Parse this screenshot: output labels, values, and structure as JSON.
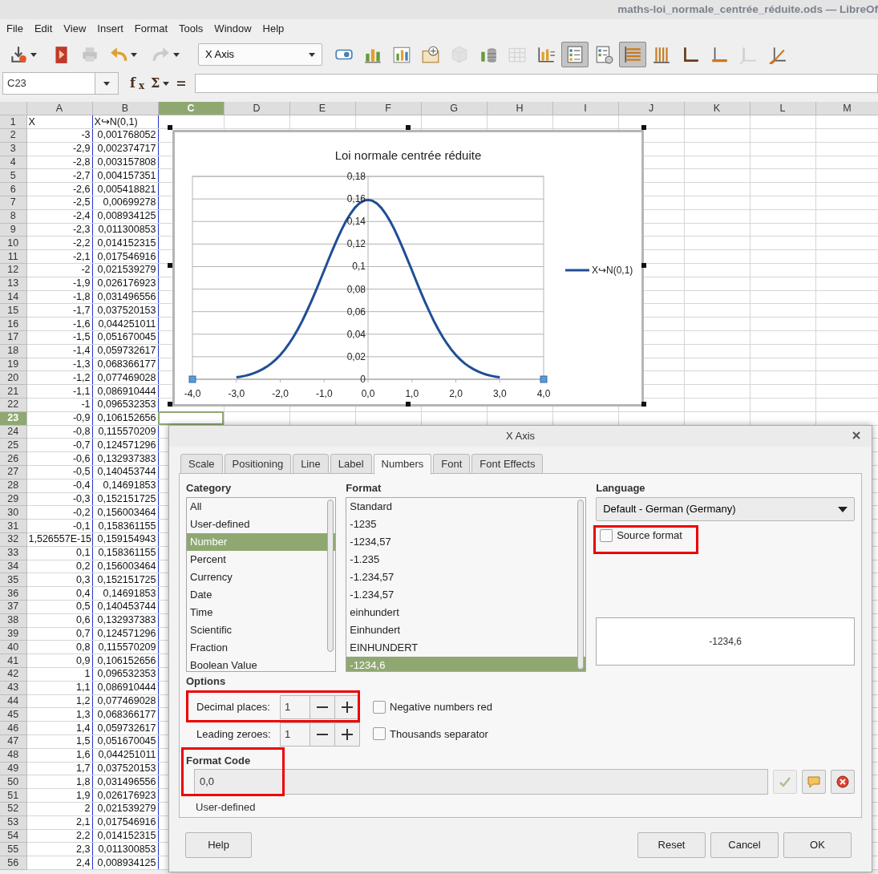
{
  "window": {
    "title": "maths-loi_normale_centrée_réduite.ods — LibreOf"
  },
  "menu": [
    "File",
    "Edit",
    "View",
    "Insert",
    "Format",
    "Tools",
    "Window",
    "Help"
  ],
  "toolbar": [
    {
      "kind": "save",
      "disabled": false,
      "pressed": false,
      "dropdown": true
    },
    {
      "kind": "pdf",
      "disabled": false,
      "pressed": false
    },
    {
      "kind": "print",
      "disabled": true,
      "pressed": false
    },
    {
      "kind": "undo",
      "disabled": false,
      "pressed": false,
      "dropdown": true
    },
    {
      "kind": "redo",
      "disabled": true,
      "pressed": false,
      "dropdown": true
    },
    {
      "kind": "select",
      "label": "X Axis"
    },
    {
      "kind": "format",
      "disabled": false,
      "pressed": false
    },
    {
      "kind": "charttype",
      "disabled": false,
      "pressed": false
    },
    {
      "kind": "datarange",
      "disabled": false,
      "pressed": false
    },
    {
      "kind": "chartdata",
      "disabled": false,
      "pressed": false
    },
    {
      "kind": "cube",
      "disabled": true,
      "pressed": false
    },
    {
      "kind": "series",
      "disabled": false,
      "pressed": false
    },
    {
      "kind": "table",
      "disabled": true,
      "pressed": false
    },
    {
      "kind": "titles",
      "disabled": false,
      "pressed": false
    },
    {
      "kind": "legendtoggle",
      "disabled": false,
      "pressed": true
    },
    {
      "kind": "legend",
      "disabled": false,
      "pressed": false
    },
    {
      "kind": "hgrid",
      "disabled": false,
      "pressed": true
    },
    {
      "kind": "vgrid",
      "disabled": false,
      "pressed": false
    },
    {
      "kind": "axes",
      "disabled": false,
      "pressed": false
    },
    {
      "kind": "xaxis",
      "disabled": false,
      "pressed": false
    },
    {
      "kind": "yaxis",
      "disabled": true,
      "pressed": false
    },
    {
      "kind": "zaxis",
      "disabled": false,
      "pressed": false
    }
  ],
  "formula_bar": {
    "name_box": "C23",
    "function_wizard": "f$_{x}$",
    "sum": "Σ",
    "equals": "="
  },
  "sheet": {
    "columns": [
      {
        "label": "A",
        "selected": false,
        "highlighted": true
      },
      {
        "label": "B",
        "selected": false,
        "highlighted": true
      },
      {
        "label": "C",
        "selected": true,
        "highlighted": false
      },
      {
        "label": "D",
        "selected": false,
        "highlighted": false
      },
      {
        "label": "E",
        "selected": false,
        "highlighted": false
      },
      {
        "label": "F",
        "selected": false,
        "highlighted": false
      },
      {
        "label": "G",
        "selected": false,
        "highlighted": false
      },
      {
        "label": "H",
        "selected": false,
        "highlighted": false
      },
      {
        "label": "I",
        "selected": false,
        "highlighted": false
      },
      {
        "label": "J",
        "selected": false,
        "highlighted": false
      },
      {
        "label": "K",
        "selected": false,
        "highlighted": false
      },
      {
        "label": "L",
        "selected": false,
        "highlighted": false
      },
      {
        "label": "M",
        "selected": false,
        "highlighted": false
      }
    ],
    "rows": [
      {
        "label": "1",
        "selected": false,
        "kind": "text",
        "cells": [
          "X",
          "X↪N(0,1)"
        ]
      },
      {
        "label": "2",
        "selected": false,
        "kind": "number",
        "cells": [
          "-3",
          "0,001768052"
        ]
      },
      {
        "label": "3",
        "selected": false,
        "kind": "number",
        "cells": [
          "-2,9",
          "0,002374717"
        ]
      },
      {
        "label": "4",
        "selected": false,
        "kind": "number",
        "cells": [
          "-2,8",
          "0,003157808"
        ]
      },
      {
        "label": "5",
        "selected": false,
        "kind": "number",
        "cells": [
          "-2,7",
          "0,004157351"
        ]
      },
      {
        "label": "6",
        "selected": false,
        "kind": "number",
        "cells": [
          "-2,6",
          "0,005418821"
        ]
      },
      {
        "label": "7",
        "selected": false,
        "kind": "number",
        "cells": [
          "-2,5",
          "0,00699278"
        ]
      },
      {
        "label": "8",
        "selected": false,
        "kind": "number",
        "cells": [
          "-2,4",
          "0,008934125"
        ]
      },
      {
        "label": "9",
        "selected": false,
        "kind": "number",
        "cells": [
          "-2,3",
          "0,011300853"
        ]
      },
      {
        "label": "10",
        "selected": false,
        "kind": "number",
        "cells": [
          "-2,2",
          "0,014152315"
        ]
      },
      {
        "label": "11",
        "selected": false,
        "kind": "number",
        "cells": [
          "-2,1",
          "0,017546916"
        ]
      },
      {
        "label": "12",
        "selected": false,
        "kind": "number",
        "cells": [
          "-2",
          "0,021539279"
        ]
      },
      {
        "label": "13",
        "selected": false,
        "kind": "number",
        "cells": [
          "-1,9",
          "0,026176923"
        ]
      },
      {
        "label": "14",
        "selected": false,
        "kind": "number",
        "cells": [
          "-1,8",
          "0,031496556"
        ]
      },
      {
        "label": "15",
        "selected": false,
        "kind": "number",
        "cells": [
          "-1,7",
          "0,037520153"
        ]
      },
      {
        "label": "16",
        "selected": false,
        "kind": "number",
        "cells": [
          "-1,6",
          "0,044251011"
        ]
      },
      {
        "label": "17",
        "selected": false,
        "kind": "number",
        "cells": [
          "-1,5",
          "0,051670045"
        ]
      },
      {
        "label": "18",
        "selected": false,
        "kind": "number",
        "cells": [
          "-1,4",
          "0,059732617"
        ]
      },
      {
        "label": "19",
        "selected": false,
        "kind": "number",
        "cells": [
          "-1,3",
          "0,068366177"
        ]
      },
      {
        "label": "20",
        "selected": false,
        "kind": "number",
        "cells": [
          "-1,2",
          "0,077469028"
        ]
      },
      {
        "label": "21",
        "selected": false,
        "kind": "number",
        "cells": [
          "-1,1",
          "0,086910444"
        ]
      },
      {
        "label": "22",
        "selected": false,
        "kind": "number",
        "cells": [
          "-1",
          "0,096532353"
        ]
      },
      {
        "label": "23",
        "selected": true,
        "kind": "number",
        "cells": [
          "-0,9",
          "0,106152656"
        ]
      },
      {
        "label": "24",
        "selected": false,
        "kind": "number",
        "cells": [
          "-0,8",
          "0,115570209"
        ]
      },
      {
        "label": "25",
        "selected": false,
        "kind": "number",
        "cells": [
          "-0,7",
          "0,124571296"
        ]
      },
      {
        "label": "26",
        "selected": false,
        "kind": "number",
        "cells": [
          "-0,6",
          "0,132937383"
        ]
      },
      {
        "label": "27",
        "selected": false,
        "kind": "number",
        "cells": [
          "-0,5",
          "0,140453744"
        ]
      },
      {
        "label": "28",
        "selected": false,
        "kind": "number",
        "cells": [
          "-0,4",
          "0,14691853"
        ]
      },
      {
        "label": "29",
        "selected": false,
        "kind": "number",
        "cells": [
          "-0,3",
          "0,152151725"
        ]
      },
      {
        "label": "30",
        "selected": false,
        "kind": "number",
        "cells": [
          "-0,2",
          "0,156003464"
        ]
      },
      {
        "label": "31",
        "selected": false,
        "kind": "number",
        "cells": [
          "-0,1",
          "0,158361155"
        ]
      },
      {
        "label": "32",
        "selected": false,
        "kind": "number",
        "cells": [
          "1,526557E-15",
          "0,159154943"
        ]
      },
      {
        "label": "33",
        "selected": false,
        "kind": "number",
        "cells": [
          "0,1",
          "0,158361155"
        ]
      },
      {
        "label": "34",
        "selected": false,
        "kind": "number",
        "cells": [
          "0,2",
          "0,156003464"
        ]
      },
      {
        "label": "35",
        "selected": false,
        "kind": "number",
        "cells": [
          "0,3",
          "0,152151725"
        ]
      },
      {
        "label": "36",
        "selected": false,
        "kind": "number",
        "cells": [
          "0,4",
          "0,14691853"
        ]
      },
      {
        "label": "37",
        "selected": false,
        "kind": "number",
        "cells": [
          "0,5",
          "0,140453744"
        ]
      },
      {
        "label": "38",
        "selected": false,
        "kind": "number",
        "cells": [
          "0,6",
          "0,132937383"
        ]
      },
      {
        "label": "39",
        "selected": false,
        "kind": "number",
        "cells": [
          "0,7",
          "0,124571296"
        ]
      },
      {
        "label": "40",
        "selected": false,
        "kind": "number",
        "cells": [
          "0,8",
          "0,115570209"
        ]
      },
      {
        "label": "41",
        "selected": false,
        "kind": "number",
        "cells": [
          "0,9",
          "0,106152656"
        ]
      },
      {
        "label": "42",
        "selected": false,
        "kind": "number",
        "cells": [
          "1",
          "0,096532353"
        ]
      },
      {
        "label": "43",
        "selected": false,
        "kind": "number",
        "cells": [
          "1,1",
          "0,086910444"
        ]
      },
      {
        "label": "44",
        "selected": false,
        "kind": "number",
        "cells": [
          "1,2",
          "0,077469028"
        ]
      },
      {
        "label": "45",
        "selected": false,
        "kind": "number",
        "cells": [
          "1,3",
          "0,068366177"
        ]
      },
      {
        "label": "46",
        "selected": false,
        "kind": "number",
        "cells": [
          "1,4",
          "0,059732617"
        ]
      },
      {
        "label": "47",
        "selected": false,
        "kind": "number",
        "cells": [
          "1,5",
          "0,051670045"
        ]
      },
      {
        "label": "48",
        "selected": false,
        "kind": "number",
        "cells": [
          "1,6",
          "0,044251011"
        ]
      },
      {
        "label": "49",
        "selected": false,
        "kind": "number",
        "cells": [
          "1,7",
          "0,037520153"
        ]
      },
      {
        "label": "50",
        "selected": false,
        "kind": "number",
        "cells": [
          "1,8",
          "0,031496556"
        ]
      },
      {
        "label": "51",
        "selected": false,
        "kind": "number",
        "cells": [
          "1,9",
          "0,026176923"
        ]
      },
      {
        "label": "52",
        "selected": false,
        "kind": "number",
        "cells": [
          "2",
          "0,021539279"
        ]
      },
      {
        "label": "53",
        "selected": false,
        "kind": "number",
        "cells": [
          "2,1",
          "0,017546916"
        ]
      },
      {
        "label": "54",
        "selected": false,
        "kind": "number",
        "cells": [
          "2,2",
          "0,014152315"
        ]
      },
      {
        "label": "55",
        "selected": false,
        "kind": "number",
        "cells": [
          "2,3",
          "0,011300853"
        ]
      },
      {
        "label": "56",
        "selected": false,
        "kind": "number",
        "cells": [
          "2,4",
          "0,008934125"
        ]
      }
    ]
  },
  "chart": {
    "selected": true,
    "x_axis_selected": true,
    "chart_data": {
      "type": "line",
      "title": "Loi normale centrée réduite",
      "x": [
        -3,
        -2.9,
        -2.8,
        -2.7,
        -2.6,
        -2.5,
        -2.4,
        -2.3,
        -2.2,
        -2.1,
        -2,
        -1.9,
        -1.8,
        -1.7,
        -1.6,
        -1.5,
        -1.4,
        -1.3,
        -1.2,
        -1.1,
        -1,
        -0.9,
        -0.8,
        -0.7,
        -0.6,
        -0.5,
        -0.4,
        -0.3,
        -0.2,
        -0.1,
        0,
        0.1,
        0.2,
        0.3,
        0.4,
        0.5,
        0.6,
        0.7,
        0.8,
        0.9,
        1,
        1.1,
        1.2,
        1.3,
        1.4,
        1.5,
        1.6,
        1.7,
        1.8,
        1.9,
        2,
        2.1,
        2.2,
        2.3,
        2.4,
        2.5,
        2.6,
        2.7,
        2.8,
        2.9,
        3
      ],
      "series": [
        {
          "name": "X↪N(0,1)",
          "color": "#1f4e96",
          "values": [
            0.001768052,
            0.002374717,
            0.003157808,
            0.004157351,
            0.005418821,
            0.00699278,
            0.008934125,
            0.011300853,
            0.014152315,
            0.017546916,
            0.021539279,
            0.026176923,
            0.031496556,
            0.037520153,
            0.044251011,
            0.051670045,
            0.059732617,
            0.068366177,
            0.077469028,
            0.086910444,
            0.096532353,
            0.106152656,
            0.115570209,
            0.124571296,
            0.132937383,
            0.140453744,
            0.14691853,
            0.152151725,
            0.156003464,
            0.158361155,
            0.159154943,
            0.158361155,
            0.156003464,
            0.152151725,
            0.14691853,
            0.140453744,
            0.132937383,
            0.124571296,
            0.115570209,
            0.106152656,
            0.096532353,
            0.086910444,
            0.077469028,
            0.068366177,
            0.059732617,
            0.051670045,
            0.044251011,
            0.037520153,
            0.031496556,
            0.026176923,
            0.021539279,
            0.017546916,
            0.014152315,
            0.011300853,
            0.008934125,
            0.00699278,
            0.005418821,
            0.004157351,
            0.003157808,
            0.002374717,
            0.001768052
          ]
        }
      ],
      "xlim": [
        -4,
        4
      ],
      "ylim": [
        0,
        0.18
      ],
      "grid": true,
      "xticks": [
        {
          "value": -4,
          "label": "-4,0"
        },
        {
          "value": -3,
          "label": "-3,0"
        },
        {
          "value": -2,
          "label": "-2,0"
        },
        {
          "value": -1,
          "label": "-1,0"
        },
        {
          "value": 0,
          "label": "0,0"
        },
        {
          "value": 1,
          "label": "1,0"
        },
        {
          "value": 2,
          "label": "2,0"
        },
        {
          "value": 3,
          "label": "3,0"
        },
        {
          "value": 4,
          "label": "4,0"
        }
      ],
      "yticks": [
        {
          "value": 0,
          "label": "0"
        },
        {
          "value": 0.02,
          "label": "0,02"
        },
        {
          "value": 0.04,
          "label": "0,04"
        },
        {
          "value": 0.06,
          "label": "0,06"
        },
        {
          "value": 0.08,
          "label": "0,08"
        },
        {
          "value": 0.1,
          "label": "0,1"
        },
        {
          "value": 0.12,
          "label": "0,12"
        },
        {
          "value": 0.14,
          "label": "0,14"
        },
        {
          "value": 0.16,
          "label": "0,16"
        },
        {
          "value": 0.18,
          "label": "0,18"
        }
      ]
    }
  },
  "dialog": {
    "title": "X Axis",
    "tabs": [
      {
        "label": "Scale",
        "selected": false
      },
      {
        "label": "Positioning",
        "selected": false
      },
      {
        "label": "Line",
        "selected": false
      },
      {
        "label": "Label",
        "selected": false
      },
      {
        "label": "Numbers",
        "selected": true
      },
      {
        "label": "Font",
        "selected": false
      },
      {
        "label": "Font Effects",
        "selected": false
      }
    ],
    "category": {
      "label": "Category",
      "items": [
        {
          "label": "All",
          "selected": false
        },
        {
          "label": "User-defined",
          "selected": false
        },
        {
          "label": "Number",
          "selected": true
        },
        {
          "label": "Percent",
          "selected": false
        },
        {
          "label": "Currency",
          "selected": false
        },
        {
          "label": "Date",
          "selected": false
        },
        {
          "label": "Time",
          "selected": false
        },
        {
          "label": "Scientific",
          "selected": false
        },
        {
          "label": "Fraction",
          "selected": false
        },
        {
          "label": "Boolean Value",
          "selected": false
        }
      ]
    },
    "format": {
      "label": "Format",
      "items": [
        {
          "label": "Standard",
          "selected": false
        },
        {
          "label": "-1235",
          "selected": false
        },
        {
          "label": "-1234,57",
          "selected": false
        },
        {
          "label": "-1.235",
          "selected": false
        },
        {
          "label": "-1.234,57",
          "selected": false
        },
        {
          "label": "-1.234,57",
          "selected": false
        },
        {
          "label": "einhundert",
          "selected": false
        },
        {
          "label": "Einhundert",
          "selected": false
        },
        {
          "label": "EINHUNDERT",
          "selected": false
        },
        {
          "label": "-1234,6",
          "selected": true
        }
      ]
    },
    "language": {
      "label": "Language",
      "value": "Default - German (Germany)"
    },
    "source_format": {
      "label": "Source format",
      "checked": false,
      "highlighted": true
    },
    "preview": "-1234,6",
    "options": {
      "label": "Options",
      "decimal_places": {
        "label": "Decimal places:",
        "value": "1",
        "highlighted": true
      },
      "leading_zeroes": {
        "label": "Leading zeroes:",
        "value": "1",
        "highlighted": false
      },
      "negative_red": {
        "label": "Negative numbers red",
        "checked": false
      },
      "thousands_separator": {
        "label": "Thousands separator",
        "checked": false
      }
    },
    "format_code": {
      "label": "Format Code",
      "value": "0,0",
      "highlighted": true,
      "description": "User-defined"
    },
    "code_buttons": [
      {
        "kind": "accept",
        "disabled": true
      },
      {
        "kind": "comment",
        "disabled": false
      },
      {
        "kind": "delete",
        "disabled": false
      }
    ],
    "help_button": "Help",
    "buttons": [
      "Reset",
      "Cancel",
      "OK"
    ]
  }
}
